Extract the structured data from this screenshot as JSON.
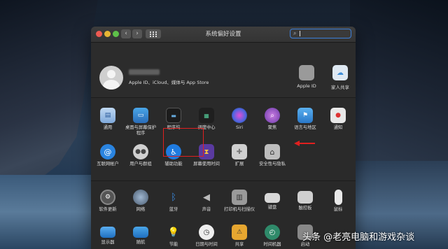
{
  "window": {
    "title": "系统偏好设置"
  },
  "toolbar": {
    "back": "‹",
    "forward": "›"
  },
  "account": {
    "subtitle": "Apple ID、iCloud、媒体与 App Store"
  },
  "top_icons": [
    {
      "label": "Apple ID",
      "icon": "apple-icon",
      "color": "#9a9a9a"
    },
    {
      "label": "家人共享",
      "icon": "family-sharing-icon",
      "color": "#4a9ad8"
    }
  ],
  "row1": [
    {
      "label": "通用",
      "icon": "general-icon"
    },
    {
      "label": "桌面与屏幕保护程序",
      "icon": "desktop-screensaver-icon"
    },
    {
      "label": "程序坞",
      "icon": "dock-icon"
    },
    {
      "label": "调度中心",
      "icon": "mission-control-icon"
    },
    {
      "label": "Siri",
      "icon": "siri-icon"
    },
    {
      "label": "聚焦",
      "icon": "spotlight-icon"
    },
    {
      "label": "语言与地区",
      "icon": "language-region-icon"
    },
    {
      "label": "通知",
      "icon": "notifications-icon"
    }
  ],
  "row2": [
    {
      "label": "互联网帐户",
      "icon": "internet-accounts-icon"
    },
    {
      "label": "用户与群组",
      "icon": "users-groups-icon"
    },
    {
      "label": "辅助功能",
      "icon": "accessibility-icon"
    },
    {
      "label": "屏幕使用时间",
      "icon": "screen-time-icon"
    },
    {
      "label": "扩展",
      "icon": "extensions-icon"
    },
    {
      "label": "安全性与隐私",
      "icon": "security-privacy-icon"
    }
  ],
  "row3": [
    {
      "label": "软件更新",
      "icon": "software-update-icon"
    },
    {
      "label": "网络",
      "icon": "network-icon"
    },
    {
      "label": "蓝牙",
      "icon": "bluetooth-icon"
    },
    {
      "label": "声音",
      "icon": "sound-icon"
    },
    {
      "label": "打印机与扫描仪",
      "icon": "printer-scanner-icon"
    },
    {
      "label": "键盘",
      "icon": "keyboard-icon"
    },
    {
      "label": "触控板",
      "icon": "trackpad-icon"
    },
    {
      "label": "鼠标",
      "icon": "mouse-icon"
    }
  ],
  "row4": [
    {
      "label": "显示器",
      "icon": "displays-icon"
    },
    {
      "label": "随航",
      "icon": "sidecar-icon"
    },
    {
      "label": "节能",
      "icon": "energy-saver-icon"
    },
    {
      "label": "日期与时间",
      "icon": "date-time-icon"
    },
    {
      "label": "共享",
      "icon": "sharing-icon"
    },
    {
      "label": "时间机器",
      "icon": "time-machine-icon"
    },
    {
      "label": "启动",
      "icon": "startup-disk-icon"
    }
  ],
  "annotation": {
    "color": "#e0201f"
  },
  "watermark": {
    "text": "头条 @老亮电脑和游戏杂谈"
  }
}
